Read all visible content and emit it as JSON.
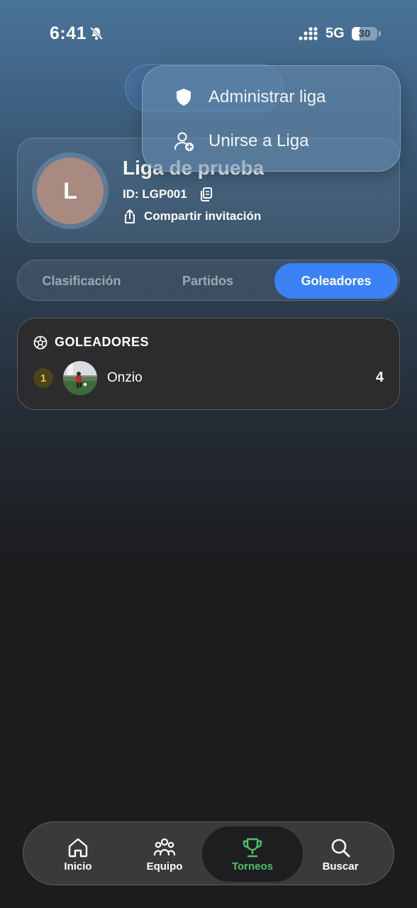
{
  "status_bar": {
    "time": "6:41",
    "network": "5G",
    "battery": "30",
    "battery_level_percent": 30
  },
  "league": {
    "avatar_letter": "L",
    "name": "Liga de prueba",
    "id_label": "ID: LGP001",
    "share_label": "Compartir invitación"
  },
  "menu": {
    "items": [
      {
        "label": "Administrar liga",
        "icon": "shield-icon"
      },
      {
        "label": "Unirse a Liga",
        "icon": "person-add-icon"
      }
    ]
  },
  "tabs": [
    {
      "label": "Clasificación",
      "active": false
    },
    {
      "label": "Partidos",
      "active": false
    },
    {
      "label": "Goleadores",
      "active": true
    }
  ],
  "scorers": {
    "title": "GOLEADORES",
    "rows": [
      {
        "rank": "1",
        "name": "Onzio",
        "goals": "4"
      }
    ]
  },
  "nav": {
    "items": [
      {
        "label": "Inicio",
        "icon": "home-icon",
        "active": false
      },
      {
        "label": "Equipo",
        "icon": "team-icon",
        "active": false
      },
      {
        "label": "Torneos",
        "icon": "trophy-icon",
        "active": true
      },
      {
        "label": "Buscar",
        "icon": "search-icon",
        "active": false
      }
    ]
  },
  "colors": {
    "accent": "#3b82f6",
    "active_nav": "#4cc069",
    "rank_gold": "#f5c518"
  }
}
